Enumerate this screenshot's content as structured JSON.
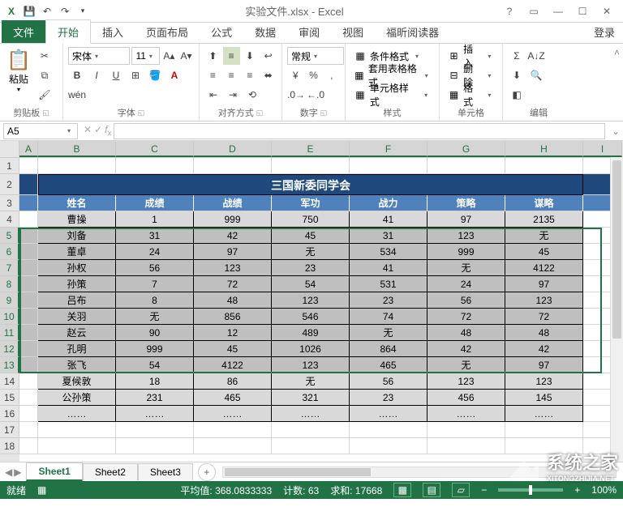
{
  "titlebar": {
    "title": "实验文件.xlsx - Excel"
  },
  "tabs": {
    "file": "文件",
    "items": [
      "开始",
      "插入",
      "页面布局",
      "公式",
      "数据",
      "审阅",
      "视图",
      "福昕阅读器"
    ],
    "active": 0,
    "login": "登录"
  },
  "ribbon": {
    "clipboard": {
      "paste": "粘贴",
      "label": "剪贴板"
    },
    "font": {
      "name": "宋体",
      "size": "11",
      "label": "字体"
    },
    "align": {
      "label": "对齐方式"
    },
    "number": {
      "format": "常规",
      "label": "数字"
    },
    "styles": {
      "cond": "条件格式",
      "table": "套用表格格式",
      "cell": "单元格样式",
      "label": "样式"
    },
    "cells": {
      "insert": "插入",
      "delete": "删除",
      "format": "格式",
      "label": "单元格"
    },
    "editing": {
      "label": "编辑"
    }
  },
  "formula": {
    "namebox": "A5",
    "fx": ""
  },
  "columns": [
    "A",
    "B",
    "C",
    "D",
    "E",
    "F",
    "G",
    "H",
    "I"
  ],
  "rows": [
    "1",
    "2",
    "3",
    "4",
    "5",
    "6",
    "7",
    "8",
    "9",
    "10",
    "11",
    "12",
    "13",
    "14",
    "15",
    "16",
    "17",
    "18"
  ],
  "table": {
    "title": "三国新委同学会",
    "headers": [
      "姓名",
      "成绩",
      "战绩",
      "军功",
      "战力",
      "策略",
      "谋略"
    ],
    "data": [
      [
        "曹操",
        "1",
        "999",
        "750",
        "41",
        "97",
        "2135"
      ],
      [
        "刘备",
        "31",
        "42",
        "45",
        "31",
        "123",
        "无"
      ],
      [
        "董卓",
        "24",
        "97",
        "无",
        "534",
        "999",
        "45"
      ],
      [
        "孙权",
        "56",
        "123",
        "23",
        "41",
        "无",
        "4122"
      ],
      [
        "孙策",
        "7",
        "72",
        "54",
        "531",
        "24",
        "97"
      ],
      [
        "吕布",
        "8",
        "48",
        "123",
        "23",
        "56",
        "123"
      ],
      [
        "关羽",
        "无",
        "856",
        "546",
        "74",
        "72",
        "72"
      ],
      [
        "赵云",
        "90",
        "12",
        "489",
        "无",
        "48",
        "48"
      ],
      [
        "孔明",
        "999",
        "45",
        "1026",
        "864",
        "42",
        "42"
      ],
      [
        "张飞",
        "54",
        "4122",
        "123",
        "465",
        "无",
        "97"
      ],
      [
        "夏候敦",
        "18",
        "86",
        "无",
        "56",
        "123",
        "123"
      ],
      [
        "公孙策",
        "231",
        "465",
        "321",
        "23",
        "456",
        "145"
      ],
      [
        "……",
        "……",
        "……",
        "……",
        "……",
        "……",
        "……"
      ]
    ]
  },
  "sheets": {
    "items": [
      "Sheet1",
      "Sheet2",
      "Sheet3"
    ],
    "active": 0
  },
  "status": {
    "ready": "就绪",
    "avg_label": "平均值:",
    "avg": "368.0833333",
    "count_label": "计数:",
    "count": "63",
    "sum_label": "求和:",
    "sum": "17668",
    "zoom": "100%"
  },
  "watermark": {
    "text": "系统之家",
    "url": "XITONGZHIJIA.NET"
  }
}
